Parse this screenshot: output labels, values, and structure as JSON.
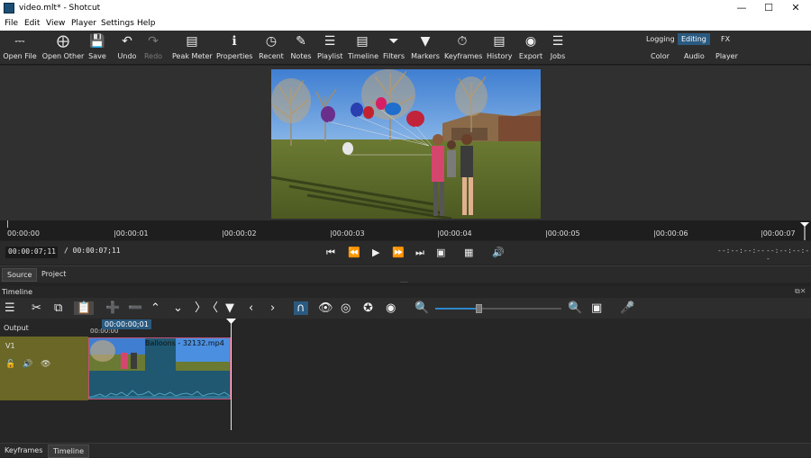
{
  "window": {
    "title": "video.mlt* - Shotcut",
    "minimize": "—",
    "maximize": "☐",
    "close": "✕"
  },
  "menu": [
    "File",
    "Edit",
    "View",
    "Player",
    "Settings",
    "Help"
  ],
  "toolbar": {
    "open_file": "Open File",
    "open_other": "Open Other",
    "save": "Save",
    "undo": "Undo",
    "redo": "Redo",
    "peak_meter": "Peak Meter",
    "properties": "Properties",
    "recent": "Recent",
    "notes": "Notes",
    "playlist": "Playlist",
    "timeline": "Timeline",
    "filters": "Filters",
    "markers": "Markers",
    "keyframes": "Keyframes",
    "history": "History",
    "export": "Export",
    "jobs": "Jobs"
  },
  "layouts": {
    "logging": "Logging",
    "editing": "Editing",
    "fx": "FX",
    "color": "Color",
    "audio": "Audio",
    "player": "Player"
  },
  "ruler": {
    "labels": [
      "00:00:00",
      "|00:00:01",
      "|00:00:02",
      "|00:00:03",
      "|00:00:04",
      "|00:00:05",
      "|00:00:06",
      "|00:00:07"
    ]
  },
  "transport": {
    "position": "00:00:07;11",
    "duration": "/ 00:00:07;11",
    "in_point": "--:--:--:--",
    "out_point": "--:--:--:--"
  },
  "tabs": {
    "source": "Source",
    "project": "Project"
  },
  "timeline_panel": {
    "title": "Timeline",
    "playhead_tooltip": "00:00:00;01",
    "ruler_start": "00:00:00",
    "tracks": {
      "output": "Output",
      "v1": "V1"
    },
    "clip_name": "Balloons - 32132.mp4"
  },
  "bottom_tabs": {
    "keyframes": "Keyframes",
    "timeline": "Timeline"
  },
  "colors": {
    "accent": "#2b5a80",
    "track_header": "#6b6727",
    "clip": "#1f5870",
    "clip_border": "#c0527a"
  }
}
